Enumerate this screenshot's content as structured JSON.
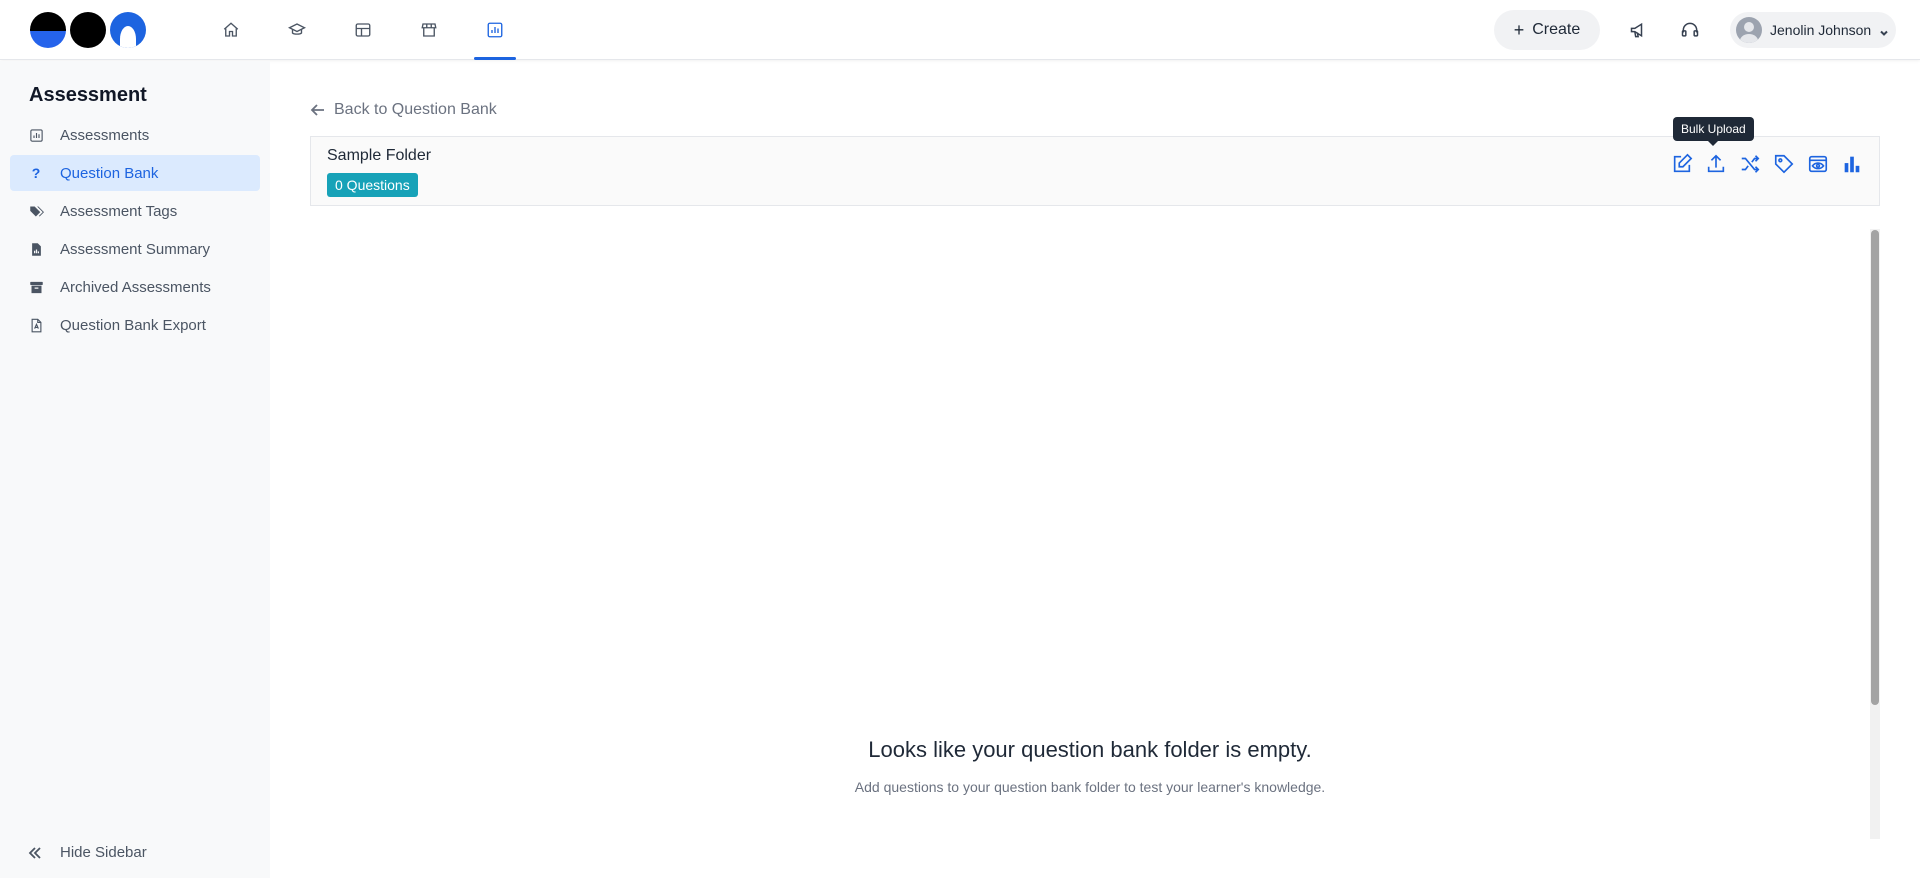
{
  "header": {
    "nav": [
      {
        "name": "home",
        "icon": "home-icon"
      },
      {
        "name": "learning",
        "icon": "graduation-cap-icon"
      },
      {
        "name": "catalog",
        "icon": "layout-icon"
      },
      {
        "name": "store",
        "icon": "store-icon"
      },
      {
        "name": "assessment",
        "icon": "chart-square-icon",
        "active": true
      }
    ],
    "create_label": "Create",
    "user_name": "Jenolin Johnson"
  },
  "sidebar": {
    "title": "Assessment",
    "items": [
      {
        "label": "Assessments",
        "icon": "chart-icon"
      },
      {
        "label": "Question Bank",
        "icon": "question-icon",
        "active": true
      },
      {
        "label": "Assessment Tags",
        "icon": "tags-icon"
      },
      {
        "label": "Assessment Summary",
        "icon": "file-chart-icon"
      },
      {
        "label": "Archived Assessments",
        "icon": "archive-icon"
      },
      {
        "label": "Question Bank Export",
        "icon": "file-pdf-icon"
      }
    ],
    "hide_label": "Hide Sidebar"
  },
  "main": {
    "back_label": "Back to Question Bank",
    "folder_name": "Sample Folder",
    "question_count": "0 Questions",
    "tooltip": "Bulk Upload",
    "empty_title": "Looks like your question bank folder is empty.",
    "empty_subtitle": "Add questions to your question bank folder to test your learner's knowledge."
  },
  "colors": {
    "accent": "#1d64e0",
    "badge": "#17a2b8",
    "sidebar_active_bg": "#dbeafe"
  }
}
